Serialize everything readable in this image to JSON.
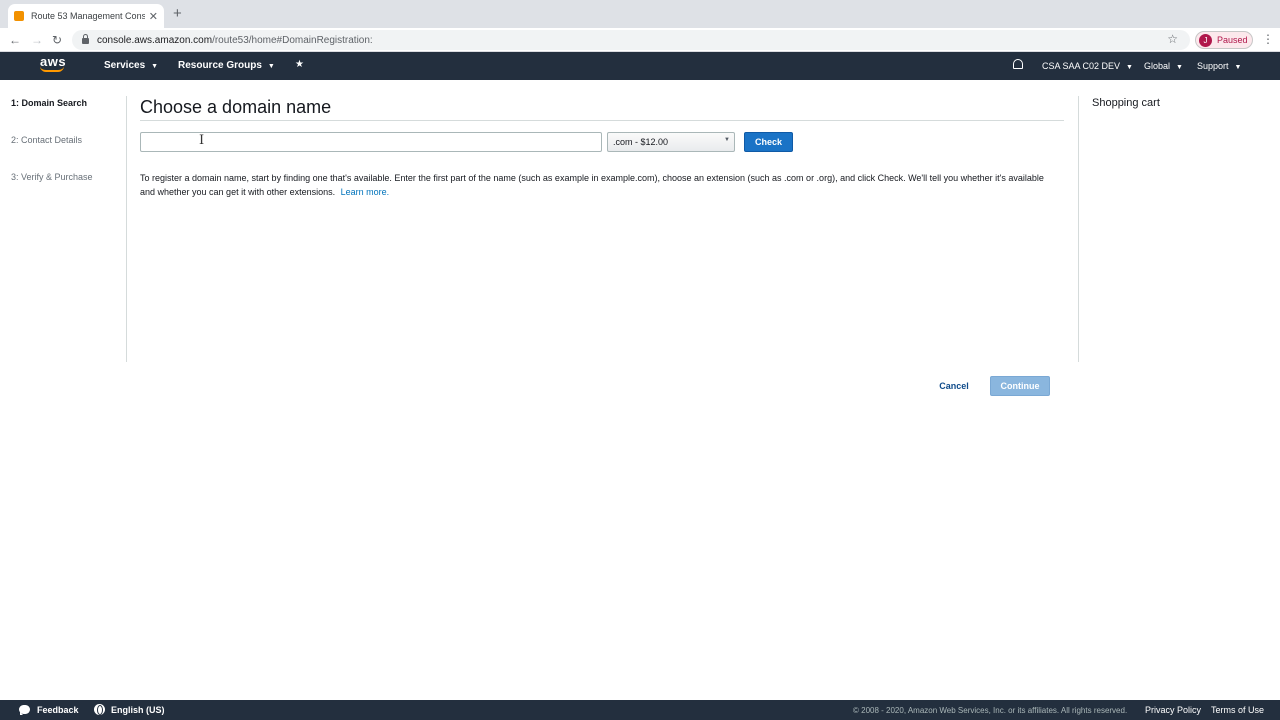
{
  "browser": {
    "tab_title": "Route 53 Management Console",
    "new_tab": "+",
    "close": "✕",
    "back": "←",
    "forward": "→",
    "reload": "↻",
    "url_host": "console.aws.amazon.com",
    "url_path": "/route53/home#DomainRegistration:",
    "star": "☆",
    "profile_initial": "J",
    "profile_status": "Paused",
    "menu": "⋮"
  },
  "aws_nav": {
    "logo": "aws",
    "services": "Services",
    "resource_groups": "Resource Groups",
    "pin": "★",
    "account": "CSA SAA C02 DEV",
    "region": "Global",
    "support": "Support",
    "caret": "▼"
  },
  "steps": [
    {
      "label": "1: Domain Search"
    },
    {
      "label": "2: Contact Details"
    },
    {
      "label": "3: Verify & Purchase"
    }
  ],
  "main": {
    "title": "Choose a domain name",
    "domain_input_value": "",
    "tld_select": ".com - $12.00",
    "check_label": "Check",
    "help_text": "To register a domain name, start by finding one that's available. Enter the first part of the name (such as example in example.com), choose an extension (such as .com or .org), and click Check. We'll tell you whether it's available and whether you can get it with other extensions.",
    "learn_more": "Learn more.",
    "cursor": "I"
  },
  "cart": {
    "title": "Shopping cart"
  },
  "actions": {
    "cancel": "Cancel",
    "continue": "Continue"
  },
  "footer": {
    "feedback": "Feedback",
    "language": "English (US)",
    "copyright": "© 2008 - 2020, Amazon Web Services, Inc. or its affiliates. All rights reserved.",
    "privacy": "Privacy Policy",
    "terms": "Terms of Use"
  },
  "colors": {
    "nav_bg": "#232f3e",
    "primary": "#1a73c6",
    "link": "#0073bb",
    "aws_orange": "#ff9900"
  }
}
